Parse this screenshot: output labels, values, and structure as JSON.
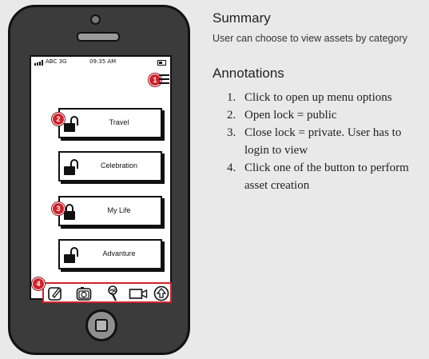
{
  "phone": {
    "status": {
      "carrier": "ABC 3G",
      "time": "09:35 AM"
    },
    "categories": [
      {
        "label": "Travel",
        "lock": "open"
      },
      {
        "label": "Celebration",
        "lock": "open"
      },
      {
        "label": "My Life",
        "lock": "closed"
      },
      {
        "label": "Advanture",
        "lock": "open"
      }
    ],
    "markers": [
      "1",
      "2",
      "3",
      "4"
    ],
    "toolbar_icons": [
      "edit-icon",
      "camera-icon",
      "microphone-icon",
      "video-icon",
      "upload-icon"
    ]
  },
  "panel": {
    "summary_title": "Summary",
    "summary_text": "User can choose to view assets by category",
    "annotations_title": "Annotations",
    "annotations": [
      {
        "num": "1.",
        "text": "Click to open up menu options"
      },
      {
        "num": "2.",
        "text": "Open lock = public"
      },
      {
        "num": "3.",
        "text": "Close lock = private. User has to login to view"
      },
      {
        "num": "4.",
        "text": "Click one of the button to perform asset creation"
      }
    ]
  },
  "colors": {
    "marker": "#d0222b",
    "phone_body": "#3b3b3b",
    "background": "#e9e9e9"
  }
}
